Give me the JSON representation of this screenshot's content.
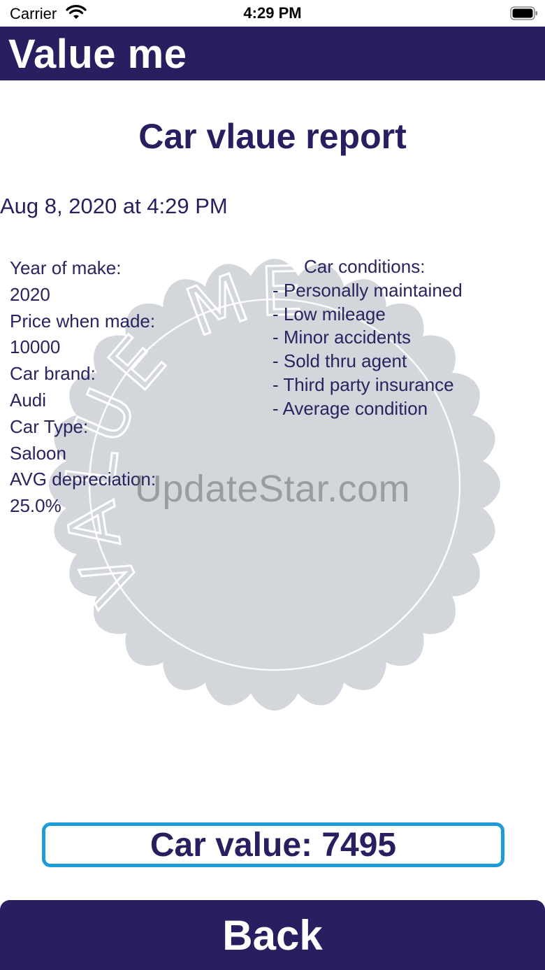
{
  "status_bar": {
    "carrier": "Carrier",
    "time": "4:29 PM",
    "wifi_icon": "wifi-icon",
    "battery_icon": "battery-icon"
  },
  "nav": {
    "title": "Value me"
  },
  "report": {
    "title": "Car vlaue report",
    "date": "Aug 8, 2020 at 4:29 PM",
    "year_label": "Year of make:",
    "year_value": "2020",
    "price_label": "Price when made:",
    "price_value": "10000",
    "brand_label": "Car brand:",
    "brand_value": "Audi",
    "type_label": "Car Type:",
    "type_value": "Saloon",
    "depreciation_label": "AVG depreciation:",
    "depreciation_value": "25.0%",
    "conditions_heading": "Car conditions:",
    "conditions": [
      "- Personally maintained",
      "- Low mileage",
      "- Minor accidents",
      "- Sold thru agent",
      "- Third party insurance",
      "- Average condition"
    ]
  },
  "seal": {
    "text": "VALUE ME",
    "color": "#d3d6da"
  },
  "watermark": "UpdateStar.com",
  "value_box": {
    "text": "Car value: 7495",
    "border_color": "#1e9bd8"
  },
  "back_button": {
    "label": "Back"
  },
  "colors": {
    "primary": "#271f5f",
    "accent": "#1e9bd8"
  }
}
